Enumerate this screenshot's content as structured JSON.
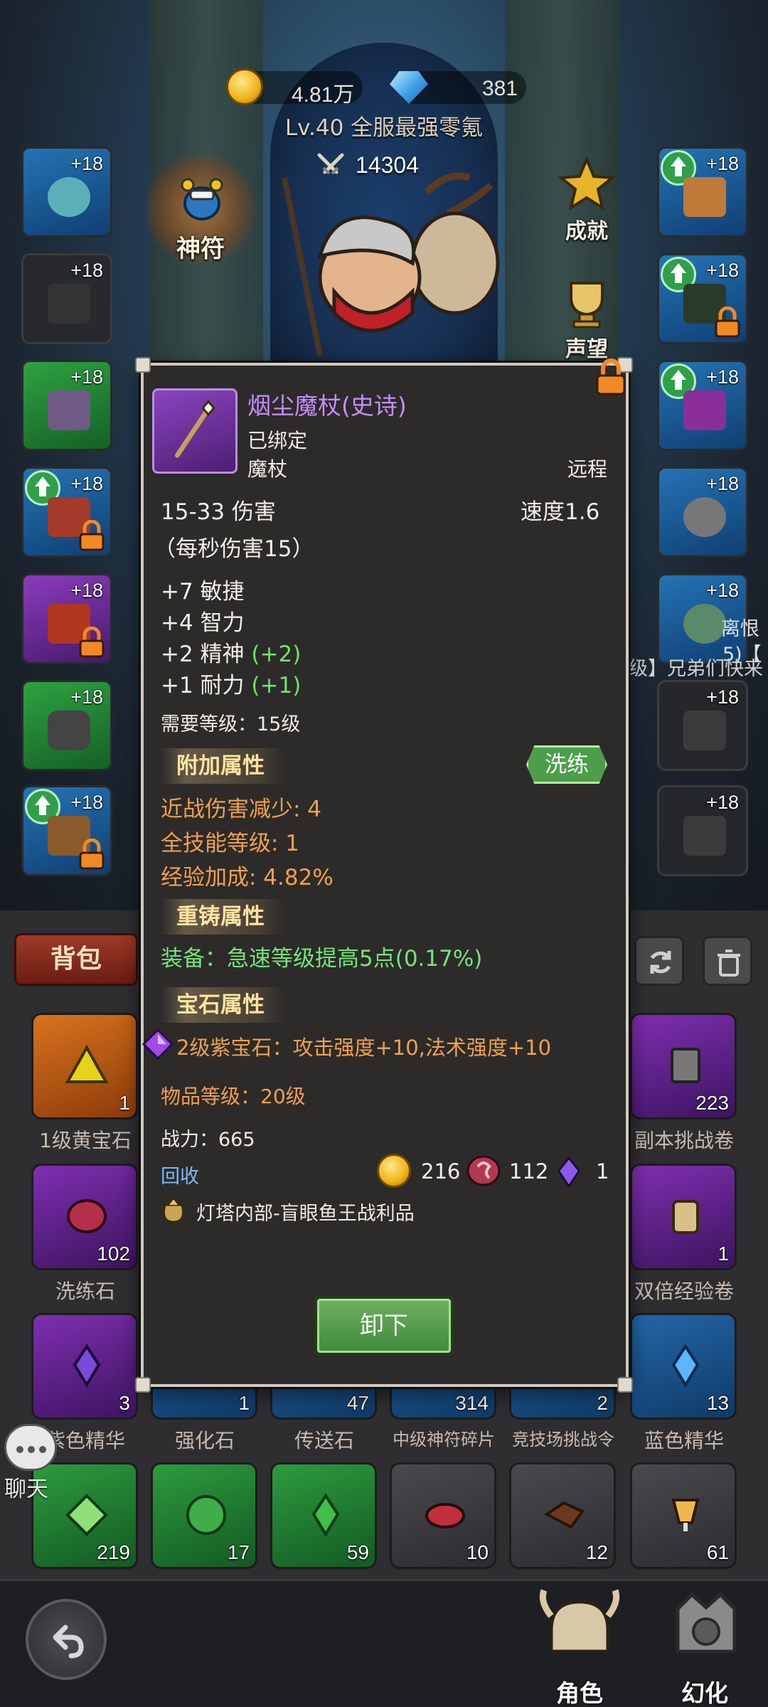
{
  "header": {
    "gold": "4.81万",
    "diamonds": "381",
    "title": "Lv.40 全服最强零氪",
    "combat_power": "14304"
  },
  "side_buttons": {
    "rune": "神符",
    "achievement": "成就",
    "reputation": "声望"
  },
  "left_slots": [
    {
      "level": "+18",
      "rarity": "blue"
    },
    {
      "level": "+18",
      "rarity": "dark"
    },
    {
      "level": "+18",
      "rarity": "green"
    },
    {
      "level": "+18",
      "rarity": "blue"
    },
    {
      "level": "+18",
      "rarity": "purple"
    },
    {
      "level": "+18",
      "rarity": "green"
    },
    {
      "level": "+18",
      "rarity": "blue"
    }
  ],
  "right_slots": [
    {
      "level": "+18",
      "rarity": "blue"
    },
    {
      "level": "+18",
      "rarity": "blue"
    },
    {
      "level": "+18",
      "rarity": "blue"
    },
    {
      "level": "+18",
      "rarity": "blue"
    },
    {
      "level": "+18",
      "rarity": "blue"
    },
    {
      "level": "+18",
      "rarity": "dark"
    },
    {
      "level": "+18",
      "rarity": "dark"
    }
  ],
  "bg_text": {
    "right_line1": "离恨",
    "right_line2": "5)【",
    "right_line3": "级】兄弟们快来"
  },
  "inventory": {
    "tab_label": "背包",
    "items": [
      {
        "name": "1级黄宝石",
        "count": "1",
        "color": "orange"
      },
      {
        "name": "副本挑战卷",
        "count": "223",
        "color": "purple"
      },
      {
        "name": "洗练石",
        "count": "102",
        "color": "purple"
      },
      {
        "name": "双倍经验卷",
        "count": "1",
        "color": "purple"
      },
      {
        "name": "紫色精华",
        "count": "3",
        "color": "purple"
      },
      {
        "name": "强化石",
        "count": "1",
        "color": "blue"
      },
      {
        "name": "传送石",
        "count": "47",
        "color": "blue"
      },
      {
        "name": "中级神符碎片",
        "count": "314",
        "color": "blue"
      },
      {
        "name": "竞技场挑战令",
        "count": "2",
        "color": "blue"
      },
      {
        "name": "蓝色精华",
        "count": "13",
        "color": "blue"
      }
    ],
    "bottom_row_counts": [
      "219",
      "17",
      "59",
      "10",
      "12",
      "61"
    ]
  },
  "chat": {
    "label": "聊天"
  },
  "nav": {
    "character": "角色",
    "transform": "幻化"
  },
  "item": {
    "name": "烟尘魔杖(史诗)",
    "bound": "已绑定",
    "type": "魔杖",
    "range": "远程",
    "damage": "15-33 伤害",
    "speed": "速度1.6",
    "dps": "（每秒伤害15）",
    "stats": [
      {
        "text": "+7 敏捷",
        "bonus": ""
      },
      {
        "text": "+4 智力",
        "bonus": ""
      },
      {
        "text": "+2 精神",
        "bonus": "(+2)"
      },
      {
        "text": "+1 耐力",
        "bonus": "(+1)"
      }
    ],
    "required_level": "需要等级：15级",
    "extra_header": "附加属性",
    "reroll_label": "洗练",
    "extra_stats": [
      "近战伤害减少: 4",
      "全技能等级: 1",
      "经验加成: 4.82%"
    ],
    "reforge_header": "重铸属性",
    "reforge_text": "装备：急速等级提高5点(0.17%)",
    "gem_header": "宝石属性",
    "gem_text": "2级紫宝石：攻击强度+10,法术强度+10",
    "item_level": "物品等级：20级",
    "power": "战力：665",
    "recycle_label": "回收",
    "recycle_gold": "216",
    "recycle_stone": "112",
    "recycle_crystal": "1",
    "source": "灯塔内部-盲眼鱼王战利品",
    "unequip_label": "卸下"
  },
  "colors": {
    "epic_purple": "#c78cff",
    "bonus_green": "#6fe36f",
    "affix_orange": "#f0a04e",
    "recycle_blue": "#7eb8ff"
  }
}
